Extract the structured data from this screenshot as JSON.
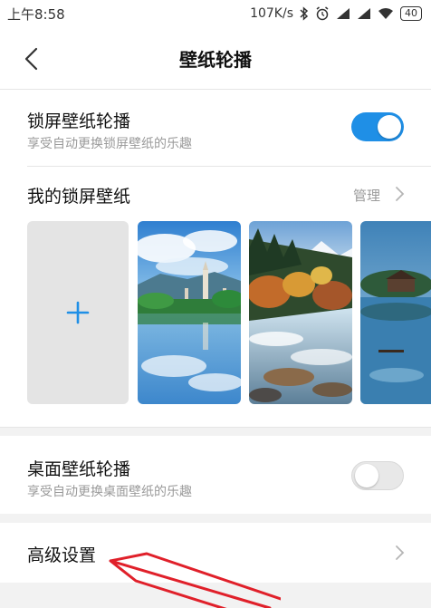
{
  "status_bar": {
    "time": "上午8:58",
    "net_speed": "107K/s",
    "battery": "40"
  },
  "header": {
    "title": "壁纸轮播",
    "back_icon": "chevron-left-icon"
  },
  "lock_screen_carousel": {
    "title": "锁屏壁纸轮播",
    "subtitle": "享受自动更换锁屏壁纸的乐趣",
    "enabled": true
  },
  "my_lock_wallpapers": {
    "title": "我的锁屏壁纸",
    "manage_label": "管理",
    "add_icon": "plus-icon",
    "thumbnails": [
      "tower-lake",
      "river-forest",
      "lake-hut"
    ]
  },
  "desktop_carousel": {
    "title": "桌面壁纸轮播",
    "subtitle": "享受自动更换桌面壁纸的乐趣",
    "enabled": false
  },
  "advanced": {
    "title": "高级设置"
  },
  "colors": {
    "accent": "#1f8fe6",
    "annotation": "#e0202a"
  }
}
